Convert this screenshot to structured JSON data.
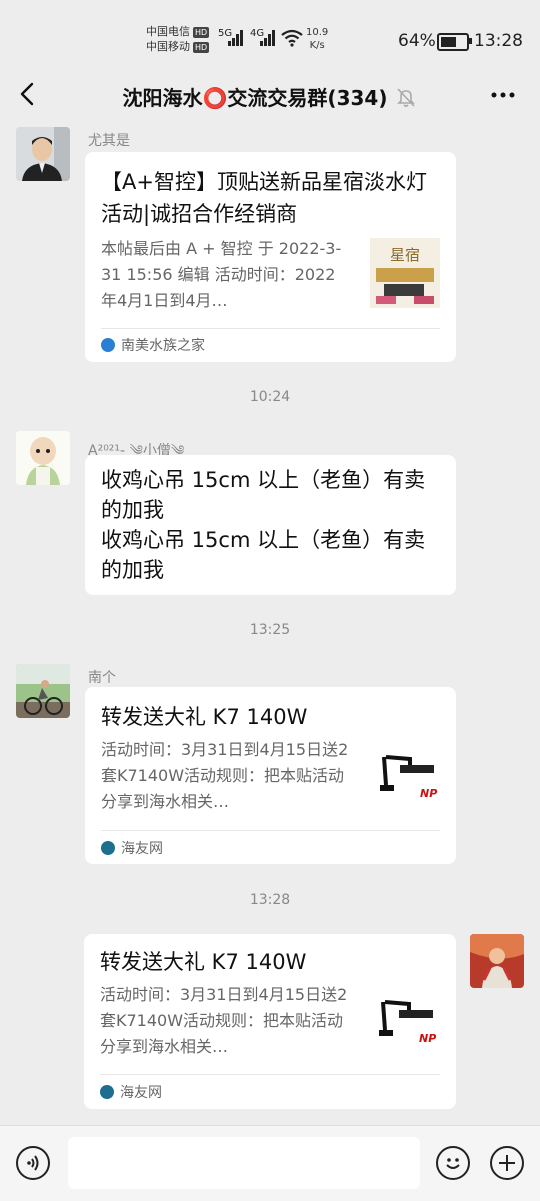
{
  "status": {
    "carrier1": "中国电信",
    "carrier2": "中国移动",
    "hd": "HD",
    "net1": "5G",
    "net2": "4G",
    "speed_value": "10.9",
    "speed_unit": "K/s",
    "battery": "64%",
    "battery_level": 0.64,
    "time": "13:28"
  },
  "header": {
    "title": "沈阳海水⭕交流交易群(334)"
  },
  "messages": {
    "m1": {
      "sender": "尤其是",
      "title": "【A+智控】顶贴送新品星宿淡水灯活动|诚招合作经销商",
      "desc": "本帖最后由 A + 智控 于 2022-3-31 15:56 编辑 活动时间：2022年4月1日到4月…",
      "thumb_text": "星宿",
      "source": "南美水族之家"
    },
    "t1": "10:24",
    "m2": {
      "sender": "A²⁰²¹- ༄小僧༄",
      "text": "收鸡心吊 15cm 以上（老鱼）有卖的加我\n收鸡心吊 15cm 以上（老鱼）有卖的加我"
    },
    "t2": "13:25",
    "m3": {
      "sender": "南个",
      "title": "转发送大礼 K7 140W",
      "desc": "活动时间：3月31日到4月15日送2套K7140W活动规则：把本贴活动分享到海水相关…",
      "thumb_text": "NP",
      "source": "海友网"
    },
    "t3": "13:28",
    "m4": {
      "title": "转发送大礼 K7 140W",
      "desc": "活动时间：3月31日到4月15日送2套K7140W活动规则：把本贴活动分享到海水相关…",
      "thumb_text": "NP",
      "source": "海友网"
    }
  },
  "icons": {
    "back": "chevron-left-icon",
    "mute": "bell-off-icon",
    "more": "more-dots-icon",
    "voice": "voice-icon",
    "emoji": "emoji-icon",
    "plus": "plus-icon"
  },
  "colors": {
    "bg": "#ededed",
    "bubble": "#ffffff",
    "source_blue": "#2a7fd4",
    "source_teal": "#1e6f8e"
  }
}
